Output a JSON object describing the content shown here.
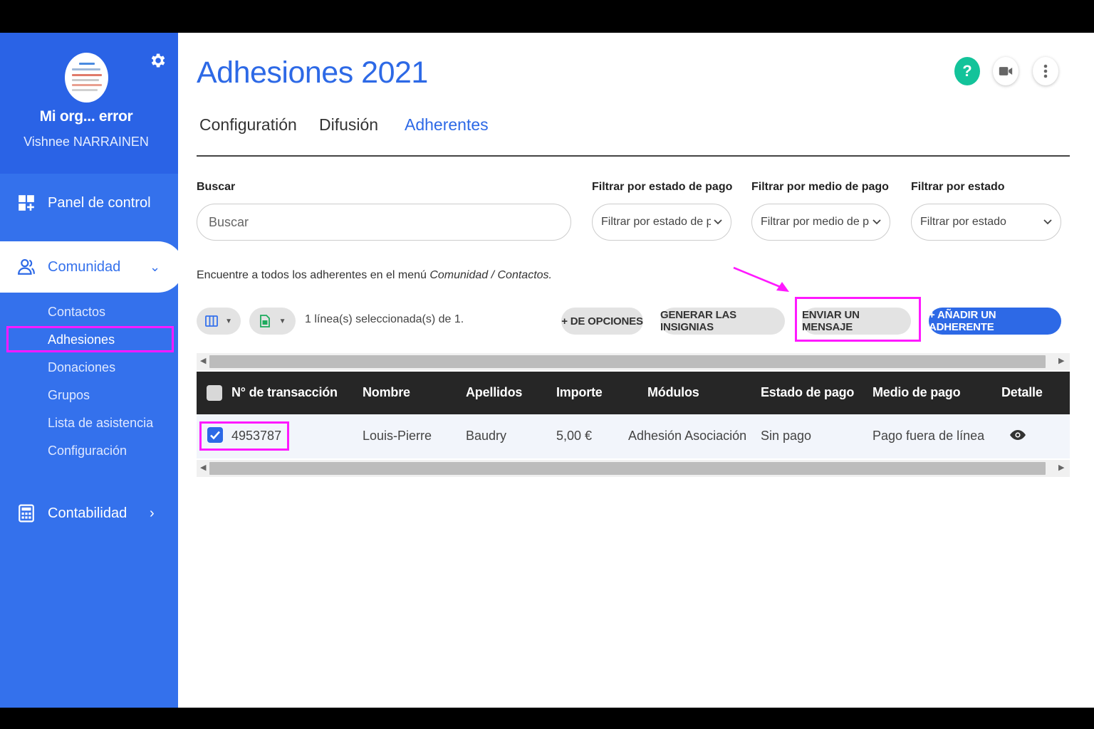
{
  "sidebar": {
    "org_name": "Mi org... error",
    "user_name": "Vishnee NARRAINEN",
    "items": [
      {
        "label": "Panel de control",
        "icon": "dashboard-icon"
      },
      {
        "label": "Comunidad",
        "icon": "community-icon"
      },
      {
        "label": "Contabilidad",
        "icon": "calculator-icon"
      }
    ],
    "submenu": [
      "Contactos",
      "Adhesiones",
      "Donaciones",
      "Grupos",
      "Lista de asistencia",
      "Configuración"
    ]
  },
  "header": {
    "title": "Adhesiones 2021",
    "help_label": "?",
    "tabs": [
      "Configuratión",
      "Difusión",
      "Adherentes"
    ]
  },
  "filters": {
    "search_label": "Buscar",
    "search_placeholder": "Buscar",
    "payment_state_label": "Filtrar por estado de pago",
    "payment_state_value": "Filtrar por estado de pago",
    "payment_method_label": "Filtrar por medio de pago",
    "payment_method_value": "Filtrar por medio de pago",
    "state_label": "Filtrar por estado",
    "state_value": "Filtrar por estado"
  },
  "hint": {
    "text": "Encuentre a todos los adherentes en el menú ",
    "path": "Comunidad / Contactos."
  },
  "toolbar": {
    "selection": "1 línea(s) seleccionada(s) de 1.",
    "more_options": "+ DE OPCIONES",
    "generate_badges": "GENERAR LAS INSIGNIAS",
    "send_message": "ENVIAR UN MENSAJE",
    "add_member": "+ AÑADIR UN ADHERENTE"
  },
  "table": {
    "headers": [
      "N° de transacción",
      "Nombre",
      "Apellidos",
      "Importe",
      "Módulos",
      "Estado de pago",
      "Medio de pago",
      "Detalle"
    ],
    "rows": [
      {
        "transaction": "4953787",
        "first_name": "Louis-Pierre",
        "last_name": "Baudry",
        "amount": "5,00 €",
        "module": "Adhesión Asociación",
        "payment_state": "Sin pago",
        "payment_method": "Pago fuera de línea"
      }
    ]
  },
  "colors": {
    "sidebar": "#3471ec",
    "accent": "#2d69e6",
    "annotation": "#ff19ff",
    "help": "#13c39a"
  }
}
